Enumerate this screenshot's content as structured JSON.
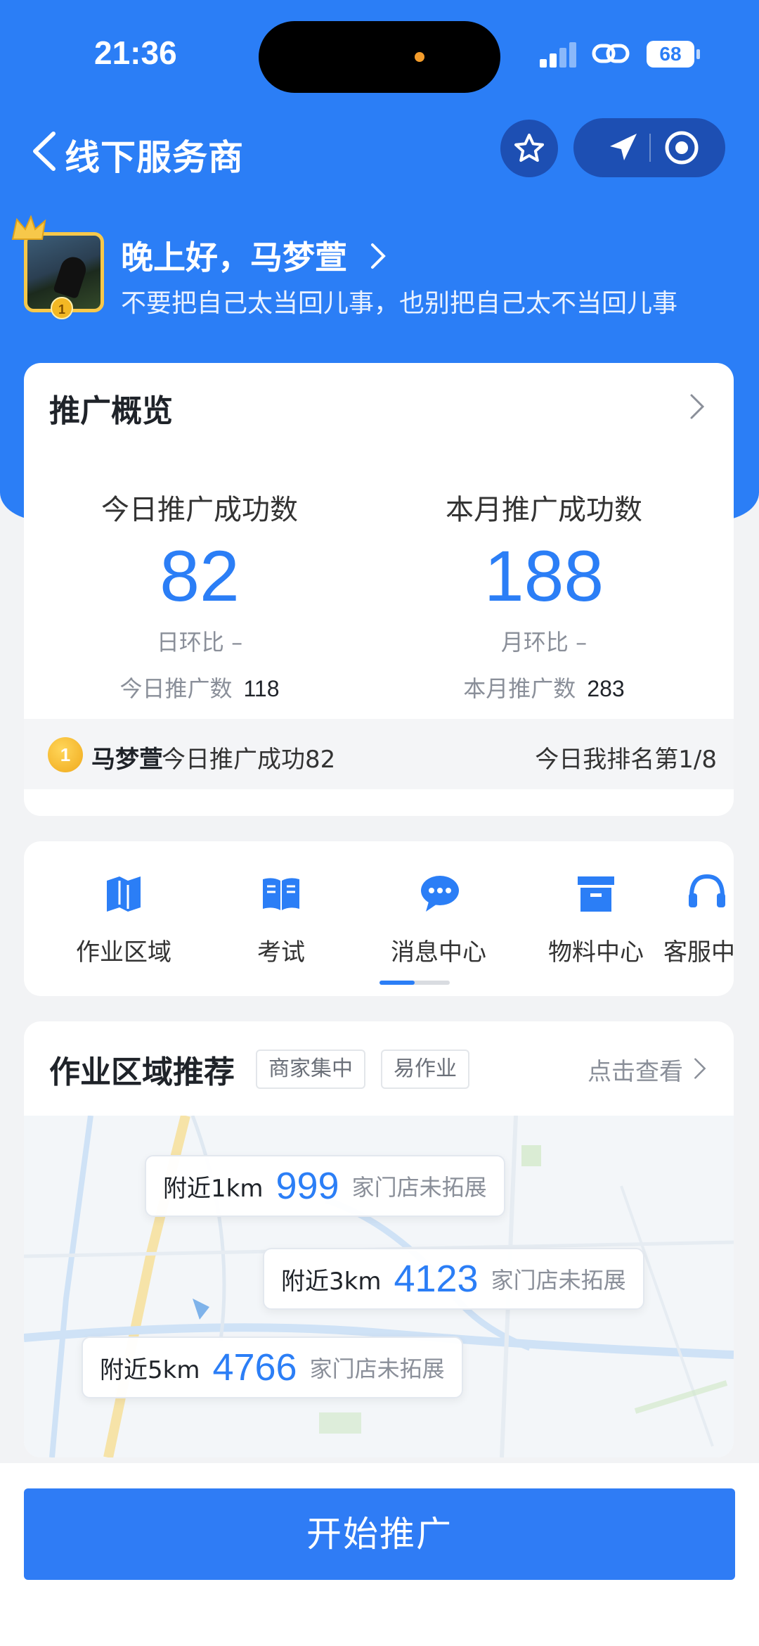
{
  "status_bar": {
    "time": "21:36",
    "battery": "68"
  },
  "navbar": {
    "title": "线下服务商"
  },
  "profile": {
    "greeting": "晚上好，马梦萱",
    "motto": "不要把自己太当回儿事，也别把自己太不当回儿事",
    "medal": "1"
  },
  "overview": {
    "title": "推广概览",
    "today": {
      "label": "今日推广成功数",
      "value": "82",
      "ratio": "日环比 –",
      "count_label": "今日推广数",
      "count": "118"
    },
    "month": {
      "label": "本月推广成功数",
      "value": "188",
      "ratio": "月环比 –",
      "count_label": "本月推广数",
      "count": "283"
    },
    "rank": {
      "medal": "1",
      "name": "马梦萱",
      "text": "今日推广成功82",
      "right": "今日我排名第1/8"
    }
  },
  "menu": {
    "items": [
      {
        "label": "作业区域",
        "icon": "map-book-icon"
      },
      {
        "label": "考试",
        "icon": "open-book-icon"
      },
      {
        "label": "消息中心",
        "icon": "chat-bubbles-icon"
      },
      {
        "label": "物料中心",
        "icon": "archive-box-icon"
      },
      {
        "label": "客服中",
        "icon": "headset-icon"
      }
    ],
    "scroll_progress": 0.5
  },
  "area": {
    "title": "作业区域推荐",
    "tags": [
      "商家集中",
      "易作业"
    ],
    "more": "点击查看",
    "pills": [
      {
        "near": "附近1km",
        "count": "999",
        "tail": "家门店未拓展"
      },
      {
        "near": "附近3km",
        "count": "4123",
        "tail": "家门店未拓展"
      },
      {
        "near": "附近5km",
        "count": "4766",
        "tail": "家门店未拓展"
      }
    ]
  },
  "actions": {
    "start": "开始推广"
  },
  "colors": {
    "primary": "#2b7ef6",
    "button": "#2f7cf5",
    "gold": "#f3b824"
  }
}
